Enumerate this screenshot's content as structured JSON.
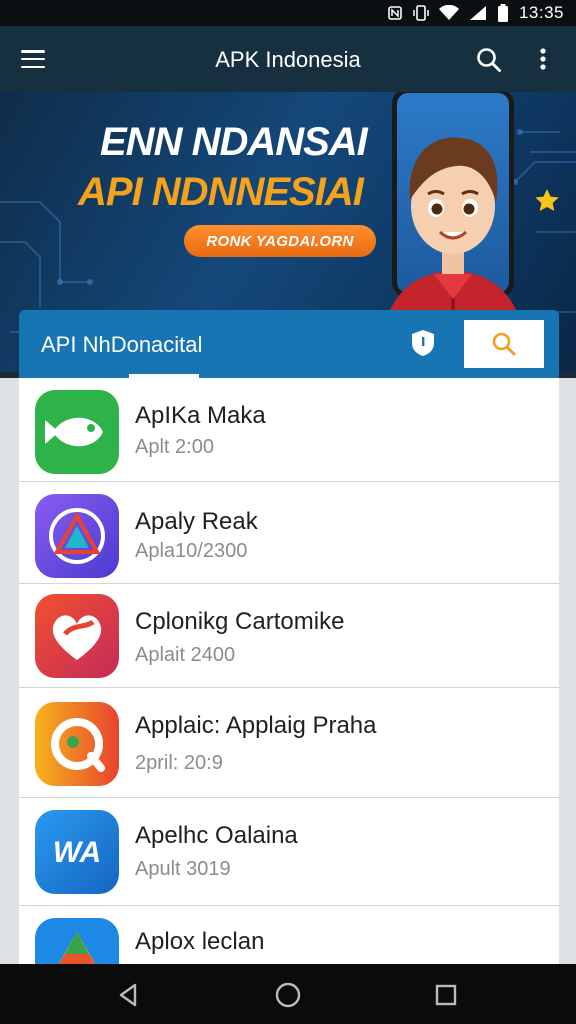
{
  "status_bar": {
    "time": "13:35",
    "icons": [
      "nfc-icon",
      "vibrate-icon",
      "wifi-icon",
      "signal-icon",
      "battery-icon"
    ]
  },
  "app_bar": {
    "title": "APK Indonesia",
    "icons": [
      "menu-icon",
      "search-icon",
      "more-vert-icon"
    ]
  },
  "banner": {
    "headline_line1": "ENN NDANSAI",
    "headline_line2": "API NDNNESIAI",
    "pill_text": "RONK YAGDAI.ORN",
    "colors": {
      "line1": "#ffffff",
      "line2": "#f6a21b",
      "pill": "#f07a1c"
    }
  },
  "search_tab": {
    "label": "API NhDonacital",
    "icons": [
      "shield-icon",
      "search-icon"
    ]
  },
  "apps": [
    {
      "name": "ApIKa Maka",
      "sub": "Aplt 2:00",
      "icon": "fish-icon",
      "color": "#2db34a"
    },
    {
      "name": "Apaly Reak",
      "sub": "Apla10/2300",
      "icon": "triangle-icon",
      "color": "#6a4fd8"
    },
    {
      "name": "Cplonikg Cartomike",
      "sub": "Aplait 2400",
      "icon": "heart-icon",
      "color": "#e8432e"
    },
    {
      "name": "Applaic: Applaig Praha",
      "sub": "2pril: 20:9",
      "icon": "chat-icon",
      "color": "#f2a31e"
    },
    {
      "name": "Apelhc Oalaina",
      "sub": "Apult 3019",
      "icon": "wa-icon",
      "color": "#1e88e5"
    },
    {
      "name": "Aplox leclan",
      "sub": "",
      "icon": "drive-icon",
      "color": "#1e88e5"
    }
  ],
  "nav_bar": {
    "icons": [
      "back-icon",
      "home-icon",
      "recents-icon"
    ]
  }
}
